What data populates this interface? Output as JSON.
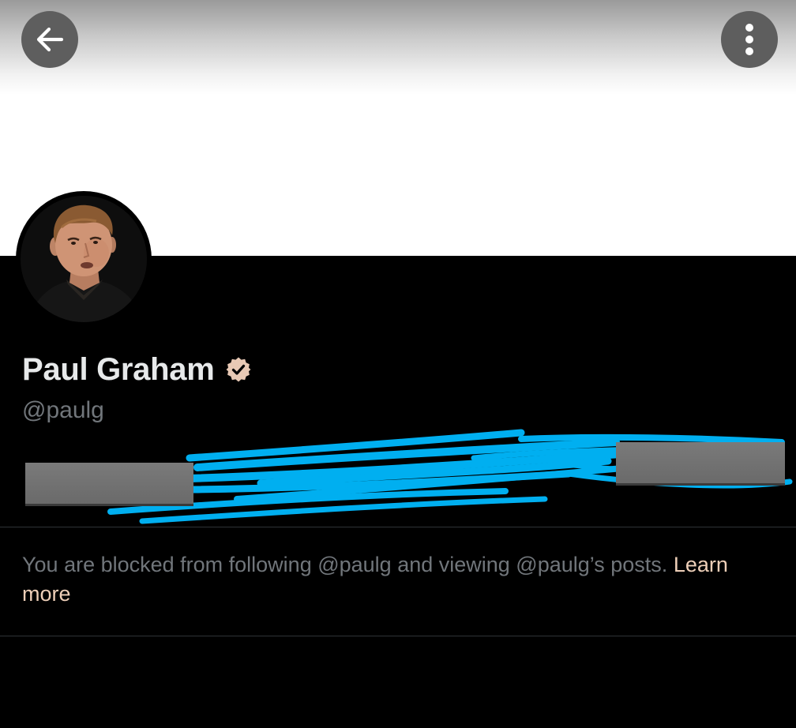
{
  "header": {
    "back_icon": "arrow-left-icon",
    "more_icon": "more-vertical-icon"
  },
  "profile": {
    "display_name": "Paul Graham",
    "verified_icon": "verified-badge-icon",
    "verified_color": "#e8c9b5",
    "handle": "@paulg"
  },
  "notice": {
    "text": "You are blocked from following @paulg and viewing @paulg’s posts.",
    "link_label": "Learn more",
    "link_color": "#eecfb8"
  },
  "colors": {
    "background": "#000000",
    "primary_text": "#e7e9ea",
    "secondary_text": "#71767b",
    "divider": "#2f3336",
    "scribble": "#00aff0"
  }
}
